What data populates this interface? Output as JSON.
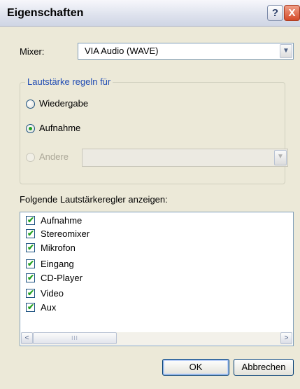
{
  "titlebar": {
    "title": "Eigenschaften",
    "help_label": "?",
    "close_label": "X"
  },
  "mixer": {
    "label": "Mixer:",
    "value": "VIA Audio (WAVE)"
  },
  "volume_group": {
    "legend": "Lautstärke regeln für",
    "options": [
      {
        "label": "Wiedergabe",
        "checked": false,
        "enabled": true
      },
      {
        "label": "Aufnahme",
        "checked": true,
        "enabled": true
      },
      {
        "label": "Andere",
        "checked": false,
        "enabled": false
      }
    ],
    "other_value": ""
  },
  "controls": {
    "label": "Folgende Lautstärkeregler anzeigen:",
    "items": [
      {
        "label": "Aufnahme",
        "checked": true
      },
      {
        "label": "Stereomixer",
        "checked": true
      },
      {
        "label": "Mikrofon",
        "checked": true
      },
      {
        "label": "Eingang",
        "checked": true
      },
      {
        "label": "CD-Player",
        "checked": true
      },
      {
        "label": "Video",
        "checked": true
      },
      {
        "label": "Aux",
        "checked": true
      }
    ],
    "scroll_left": "<",
    "scroll_right": ">",
    "thumb_grip": "III"
  },
  "buttons": {
    "ok": "OK",
    "cancel": "Abbrechen"
  },
  "icons": {
    "dropdown": "▼",
    "checkmark": "✔"
  }
}
